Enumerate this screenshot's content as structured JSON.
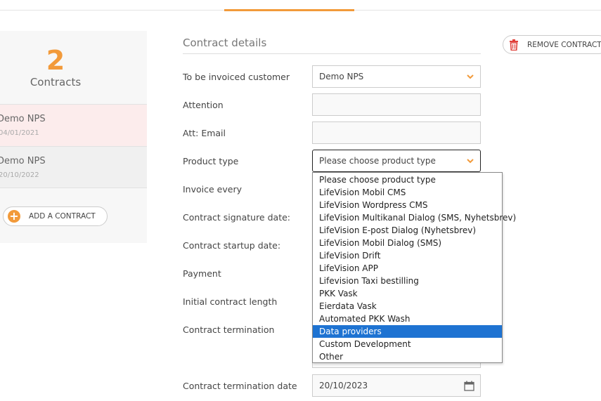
{
  "sidebar": {
    "count": "2",
    "count_label": "Contracts",
    "contracts": [
      {
        "name": "Demo NPS",
        "date": "04/01/2021"
      },
      {
        "name": "Demo NPS",
        "date": "20/10/2022"
      }
    ],
    "add_label": "ADD A CONTRACT"
  },
  "form": {
    "title": "Contract details",
    "remove_label": "REMOVE CONTRACT",
    "labels": {
      "customer": "To be invoiced customer",
      "attention": "Attention",
      "att_email": "Att: Email",
      "product_type": "Product type",
      "invoice_every": "Invoice every",
      "signature_date": "Contract signature date:",
      "startup_date": "Contract startup date:",
      "payment": "Payment",
      "initial_length": "Initial contract length",
      "termination": "Contract termination",
      "termination_date": "Contract termination date"
    },
    "values": {
      "customer": "Demo NPS",
      "attention": "",
      "att_email": "",
      "product_type": "Please choose product type",
      "termination_date": "20/10/2023"
    },
    "product_options": [
      "Please choose product type",
      "LifeVision Mobil CMS",
      "LifeVision Wordpress CMS",
      "LifeVision Multikanal Dialog (SMS, Nyhetsbrev)",
      "LifeVision E-post Dialog (Nyhetsbrev)",
      "LifeVision Mobil Dialog (SMS)",
      "LifeVision Drift",
      "LifeVision APP",
      "Lifevision Taxi bestilling",
      "PKK Vask",
      "Eierdata Vask",
      "Automated PKK Wash",
      "Data providers",
      "Custom Development",
      "Other"
    ],
    "highlighted_option": "Data providers"
  },
  "colors": {
    "accent": "#f29a3a",
    "selection": "#1e73d2",
    "remove_icon": "#e0403a"
  },
  "icons": [
    "trash-icon",
    "plus-icon",
    "chevron-down-icon",
    "calendar-icon"
  ]
}
